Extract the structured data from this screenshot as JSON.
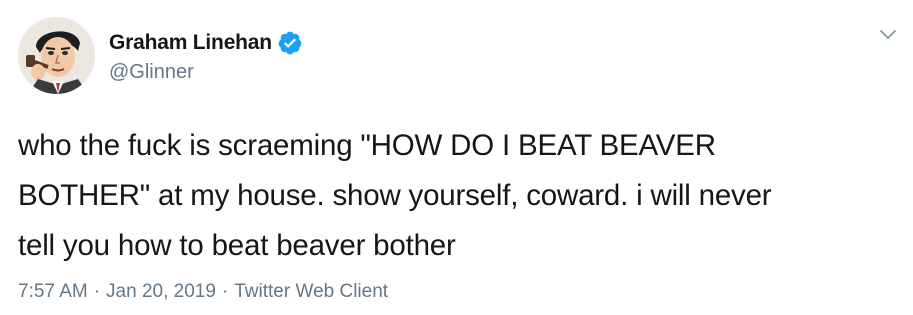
{
  "tweet": {
    "author": {
      "display_name": "Graham Linehan",
      "handle": "@Glinner",
      "verified": true
    },
    "text": "who the fuck is scraeming \"HOW DO I BEAT BEAVER\nBOTHER\" at my house. show yourself, coward. i will never\ntell you how to beat beaver bother",
    "time": "7:57 AM",
    "date": "Jan 20, 2019",
    "source": "Twitter Web Client",
    "separator": "·"
  },
  "icons": {
    "verified": "verified-badge-icon",
    "menu": "chevron-down-icon"
  },
  "colors": {
    "text": "#14171a",
    "secondary": "#657786",
    "verified_blue": "#1da1f2"
  }
}
